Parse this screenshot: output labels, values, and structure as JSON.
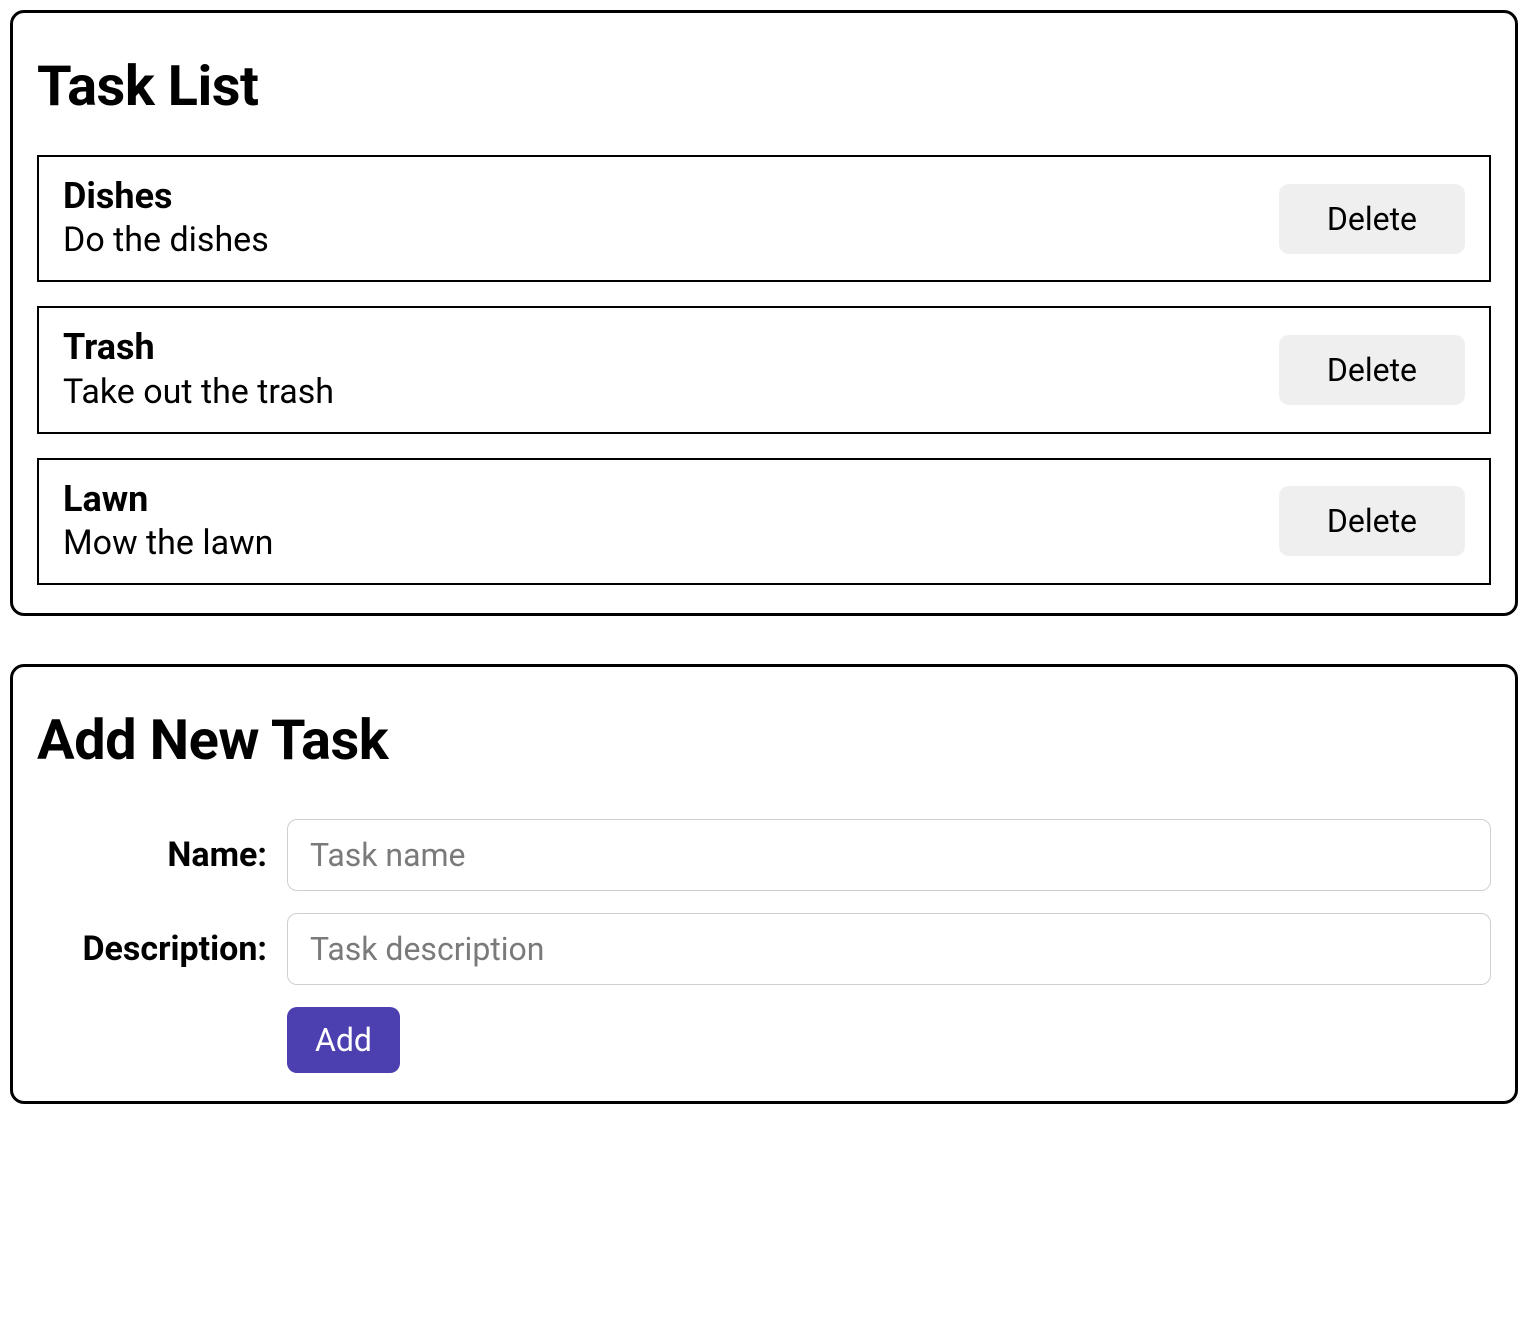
{
  "taskList": {
    "title": "Task List",
    "deleteLabel": "Delete",
    "tasks": [
      {
        "name": "Dishes",
        "description": "Do the dishes"
      },
      {
        "name": "Trash",
        "description": "Take out the trash"
      },
      {
        "name": "Lawn",
        "description": "Mow the lawn"
      }
    ]
  },
  "addForm": {
    "title": "Add New Task",
    "nameLabel": "Name:",
    "namePlaceholder": "Task name",
    "descLabel": "Description:",
    "descPlaceholder": "Task description",
    "addLabel": "Add"
  }
}
